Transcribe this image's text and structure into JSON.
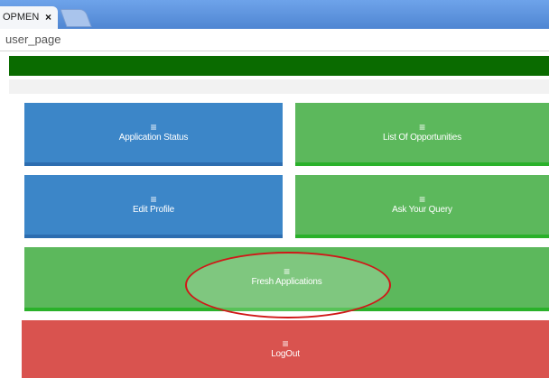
{
  "browser": {
    "tab_title": "OPMEN",
    "tab_close": "×",
    "url": "user_page"
  },
  "tiles": {
    "application_status": {
      "icon": "≡",
      "label": "Application Status"
    },
    "list_of_opportunities": {
      "icon": "≡",
      "label": "List Of Opportunities"
    },
    "edit_profile": {
      "icon": "≡",
      "label": "Edit Profile"
    },
    "ask_your_query": {
      "icon": "≡",
      "label": "Ask Your Query"
    },
    "fresh_applications": {
      "icon": "≡",
      "label": "Fresh Applications"
    },
    "logout": {
      "icon": "≡",
      "label": "LogOut"
    }
  },
  "colors": {
    "header": "#0a6b00",
    "blue": "#3c86c8",
    "green": "#5cb85c",
    "red": "#d9534f",
    "highlight": "#d01818"
  }
}
